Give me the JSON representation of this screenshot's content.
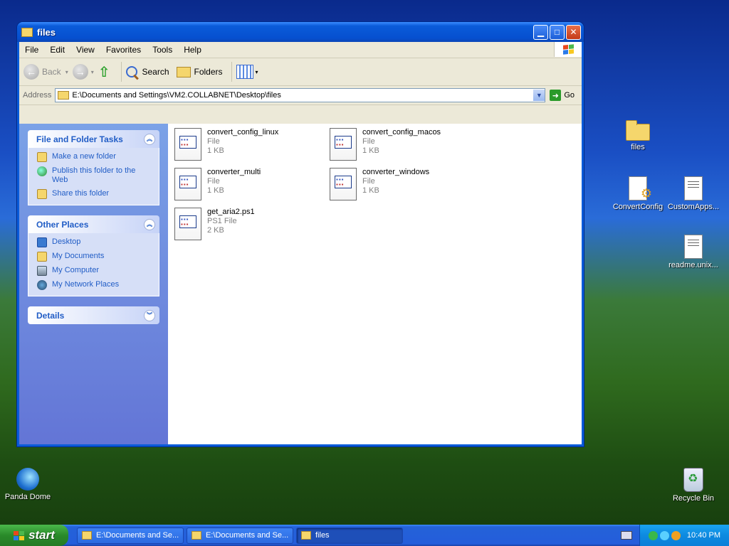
{
  "desktop": {
    "icons": [
      {
        "label": "Panda Dome",
        "icon": "panda-dome-icon"
      },
      {
        "label": "files",
        "icon": "folder-icon"
      },
      {
        "label": "ConvertConfig",
        "icon": "config-script-icon"
      },
      {
        "label": "CustomApps...",
        "icon": "text-file-icon"
      },
      {
        "label": "readme.unix...",
        "icon": "text-file-icon"
      },
      {
        "label": "Recycle Bin",
        "icon": "recycle-bin-icon"
      }
    ]
  },
  "window": {
    "title": "files",
    "menu": [
      "File",
      "Edit",
      "View",
      "Favorites",
      "Tools",
      "Help"
    ],
    "toolbar": {
      "back": "Back",
      "search": "Search",
      "folders": "Folders"
    },
    "address": {
      "label": "Address",
      "value": "E:\\Documents and Settings\\VM2.COLLABNET\\Desktop\\files",
      "go": "Go"
    },
    "tasks": {
      "file_folder_tasks": {
        "title": "File and Folder Tasks",
        "links": [
          "Make a new folder",
          "Publish this folder to the Web",
          "Share this folder"
        ]
      },
      "other_places": {
        "title": "Other Places",
        "links": [
          "Desktop",
          "My Documents",
          "My Computer",
          "My Network Places"
        ]
      },
      "details": {
        "title": "Details"
      }
    },
    "files": [
      {
        "name": "convert_config_linux",
        "type": "File",
        "size": "1 KB"
      },
      {
        "name": "convert_config_macos",
        "type": "File",
        "size": "1 KB"
      },
      {
        "name": "converter_multi",
        "type": "File",
        "size": "1 KB"
      },
      {
        "name": "converter_windows",
        "type": "File",
        "size": "1 KB"
      },
      {
        "name": "get_aria2.ps1",
        "type": "PS1 File",
        "size": "2 KB"
      }
    ]
  },
  "taskbar": {
    "start": "start",
    "tasks": [
      {
        "label": "E:\\Documents and Se..."
      },
      {
        "label": "E:\\Documents and Se..."
      },
      {
        "label": "files"
      }
    ],
    "clock": "10:40 PM"
  }
}
